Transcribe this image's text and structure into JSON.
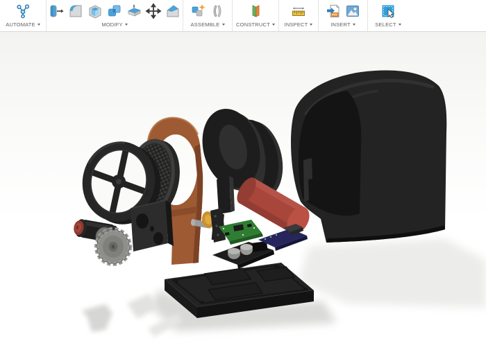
{
  "toolbar": {
    "sections": [
      {
        "label": "AUTOMATE",
        "icons": [
          "automate-icon"
        ]
      },
      {
        "label": "MODIFY",
        "icons": [
          "press-pull-icon",
          "fillet-icon",
          "shell-icon",
          "combine-icon",
          "offset-face-icon",
          "move-copy-icon",
          "chamfer-icon"
        ]
      },
      {
        "label": "ASSEMBLE",
        "icons": [
          "new-component-icon",
          "joint-icon"
        ]
      },
      {
        "label": "CONSTRUCT",
        "icons": [
          "construction-plane-icon"
        ]
      },
      {
        "label": "INSPECT",
        "icons": [
          "measure-icon"
        ]
      },
      {
        "label": "INSERT",
        "icons": [
          "insert-file-icon",
          "canvas-image-icon"
        ]
      },
      {
        "label": "SELECT",
        "icons": [
          "select-box-icon"
        ]
      }
    ]
  },
  "scene": {
    "background_top": "#f3f3f1",
    "background_bottom": "#ffffff",
    "shadow_color": "#dcdcda",
    "colors": {
      "cover": "#232323",
      "cover_interior": "#141414",
      "front_ring": "#1d1d1d",
      "spacer_ring": "#1c1c1c",
      "cylinder": "#a8463c",
      "cylinder_cap": "#bb5044",
      "frame": "#9e5a33",
      "frame_shade": "#7c4226",
      "grille": "#3d3d3b",
      "wheel": "#262626",
      "motor": "#1e1e1e",
      "motor_cap": "#a5463a",
      "gear": "#8e8e8b",
      "plate": "#2c2c2c",
      "coupler": "#c89030",
      "shaft": "#9c9c9a",
      "pcb_green": "#2f7d32",
      "board_black": "#1d1d1d",
      "pcb_blue": "#26265c",
      "tray": "#232323"
    }
  }
}
